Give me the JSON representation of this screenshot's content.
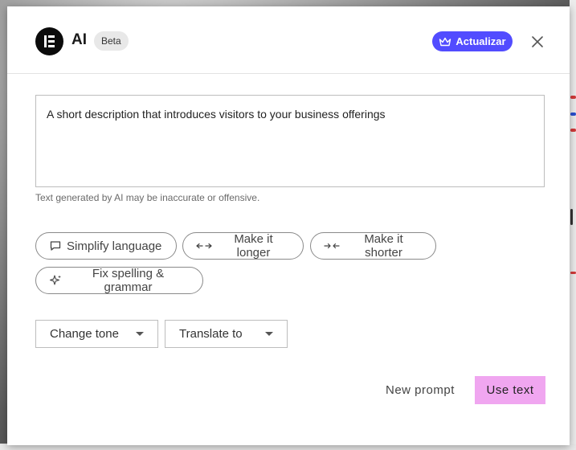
{
  "header": {
    "title": "AI",
    "badge": "Beta",
    "upgrade_label": "Actualizar",
    "close_icon": "close-icon",
    "logo_icon": "elementor-logo-icon"
  },
  "prompt": {
    "text": "A short description that introduces visitors to your business offerings"
  },
  "disclaimer": "Text generated by AI may be inaccurate or offensive.",
  "actions": [
    {
      "label": "Simplify language",
      "icon": "speech-bubble-icon"
    },
    {
      "label": "Make it longer",
      "icon": "arrows-out-icon"
    },
    {
      "label": "Make it shorter",
      "icon": "arrows-in-icon"
    },
    {
      "label": "Fix spelling & grammar",
      "icon": "sparkle-icon"
    }
  ],
  "selects": {
    "tone": "Change tone",
    "translate": "Translate to"
  },
  "footer": {
    "new_prompt_label": "New prompt",
    "use_text_label": "Use text"
  },
  "colors": {
    "upgrade_bg": "#524cff",
    "use_text_bg": "#f0a6f0",
    "badge_bg": "#e8e8e8"
  }
}
